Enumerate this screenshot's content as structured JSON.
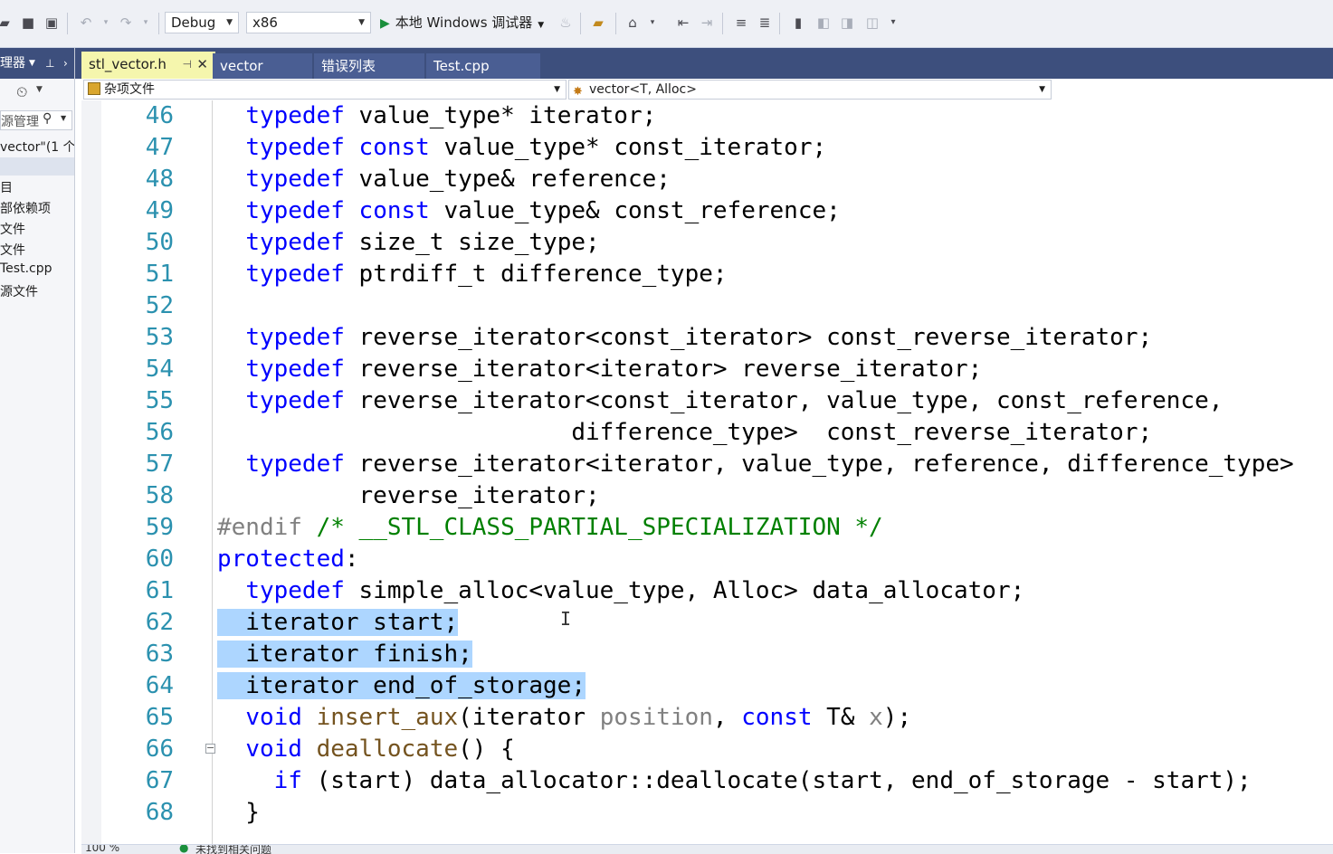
{
  "toolbar": {
    "config": "Debug",
    "platform": "x86",
    "run_label": "本地 Windows 调试器"
  },
  "left_panel": {
    "header": "理器",
    "search_label": "源管理",
    "items": [
      "vector\"(1 个",
      "目",
      "部依赖项",
      "文件",
      "文件",
      "Test.cpp",
      "源文件"
    ]
  },
  "tabs": [
    {
      "label": "stl_vector.h",
      "active": true
    },
    {
      "label": "vector",
      "active": false
    },
    {
      "label": "错误列表",
      "active": false
    },
    {
      "label": "Test.cpp",
      "active": false
    }
  ],
  "nav": {
    "scope": "杂项文件",
    "member": "vector<T, Alloc>"
  },
  "code": {
    "lines": [
      {
        "n": "46",
        "parts": [
          [
            "  ",
            ""
          ],
          [
            "typedef",
            "kw"
          ],
          [
            " value_type* iterator;",
            ""
          ]
        ]
      },
      {
        "n": "47",
        "parts": [
          [
            "  ",
            ""
          ],
          [
            "typedef",
            "kw"
          ],
          [
            " ",
            ""
          ],
          [
            "const",
            "kw"
          ],
          [
            " value_type* const_iterator;",
            ""
          ]
        ]
      },
      {
        "n": "48",
        "parts": [
          [
            "  ",
            ""
          ],
          [
            "typedef",
            "kw"
          ],
          [
            " value_type& reference;",
            ""
          ]
        ]
      },
      {
        "n": "49",
        "parts": [
          [
            "  ",
            ""
          ],
          [
            "typedef",
            "kw"
          ],
          [
            " ",
            ""
          ],
          [
            "const",
            "kw"
          ],
          [
            " value_type& const_reference;",
            ""
          ]
        ]
      },
      {
        "n": "50",
        "parts": [
          [
            "  ",
            ""
          ],
          [
            "typedef",
            "kw"
          ],
          [
            " size_t size_type;",
            ""
          ]
        ]
      },
      {
        "n": "51",
        "parts": [
          [
            "  ",
            ""
          ],
          [
            "typedef",
            "kw"
          ],
          [
            " ptrdiff_t difference_type;",
            ""
          ]
        ]
      },
      {
        "n": "52",
        "parts": [
          [
            "",
            ""
          ]
        ]
      },
      {
        "n": "53",
        "parts": [
          [
            "  ",
            ""
          ],
          [
            "typedef",
            "kw"
          ],
          [
            " reverse_iterator<const_iterator> const_reverse_iterator;",
            ""
          ]
        ]
      },
      {
        "n": "54",
        "parts": [
          [
            "  ",
            ""
          ],
          [
            "typedef",
            "kw"
          ],
          [
            " reverse_iterator<iterator> reverse_iterator;",
            ""
          ]
        ]
      },
      {
        "n": "55",
        "parts": [
          [
            "  ",
            ""
          ],
          [
            "typedef",
            "kw"
          ],
          [
            " reverse_iterator<const_iterator, value_type, const_reference,",
            ""
          ]
        ]
      },
      {
        "n": "56",
        "parts": [
          [
            "                         difference_type>  const_reverse_iterator;",
            ""
          ]
        ]
      },
      {
        "n": "57",
        "parts": [
          [
            "  ",
            ""
          ],
          [
            "typedef",
            "kw"
          ],
          [
            " reverse_iterator<iterator, value_type, reference, difference_type>",
            ""
          ]
        ]
      },
      {
        "n": "58",
        "parts": [
          [
            "          reverse_iterator;",
            ""
          ]
        ]
      },
      {
        "n": "59",
        "parts": [
          [
            "#endif",
            "pre"
          ],
          [
            " ",
            ""
          ],
          [
            "/* __STL_CLASS_PARTIAL_SPECIALIZATION */",
            "cm"
          ]
        ]
      },
      {
        "n": "60",
        "parts": [
          [
            "protected",
            "kw"
          ],
          [
            ":",
            ""
          ]
        ]
      },
      {
        "n": "61",
        "parts": [
          [
            "  ",
            ""
          ],
          [
            "typedef",
            "kw"
          ],
          [
            " simple_alloc<value_type, Alloc> data_allocator;",
            ""
          ]
        ]
      },
      {
        "n": "62",
        "parts": [
          [
            "  iterator start;",
            "sel"
          ]
        ]
      },
      {
        "n": "63",
        "parts": [
          [
            "  iterator finish;",
            "sel"
          ]
        ]
      },
      {
        "n": "64",
        "parts": [
          [
            "  iterator end_of_storage;",
            "sel"
          ]
        ]
      },
      {
        "n": "65",
        "parts": [
          [
            "  ",
            ""
          ],
          [
            "void",
            "kw"
          ],
          [
            " ",
            ""
          ],
          [
            "insert_aux",
            "fn"
          ],
          [
            "(iterator ",
            ""
          ],
          [
            "position",
            "pm"
          ],
          [
            ", ",
            ""
          ],
          [
            "const",
            "kw"
          ],
          [
            " T& ",
            ""
          ],
          [
            "x",
            "pm"
          ],
          [
            ");",
            ""
          ]
        ]
      },
      {
        "n": "66",
        "parts": [
          [
            "  ",
            ""
          ],
          [
            "void",
            "kw"
          ],
          [
            " ",
            ""
          ],
          [
            "deallocate",
            "fn"
          ],
          [
            "() {",
            ""
          ]
        ]
      },
      {
        "n": "67",
        "parts": [
          [
            "    ",
            ""
          ],
          [
            "if",
            "kw"
          ],
          [
            " (start) data_allocator::deallocate(start, end_of_storage - start);",
            ""
          ]
        ]
      },
      {
        "n": "68",
        "parts": [
          [
            "  }",
            ""
          ]
        ]
      }
    ]
  },
  "status": {
    "zoom": "100 %",
    "issues": "未找到相关问题"
  },
  "colors": {
    "keyword": "#0000ff",
    "line_number": "#2b91af",
    "comment": "#008000",
    "selection": "#add6ff",
    "tab_strip": "#3d4f7d",
    "active_tab": "#f5f6ad"
  },
  "icons": [
    "open-folder-icon",
    "save-icon",
    "save-all-icon",
    "undo-icon",
    "redo-icon",
    "play-icon",
    "fire-icon",
    "folder-find-icon",
    "home-icon",
    "step-icon",
    "indent-icon",
    "outdent-icon",
    "comment-icon",
    "uncomment-icon",
    "bookmark-icon",
    "prev-bookmark-icon",
    "next-bookmark-icon",
    "clear-bookmark-icon",
    "overflow-icon",
    "pin-icon",
    "close-icon",
    "history-icon",
    "search-icon"
  ]
}
